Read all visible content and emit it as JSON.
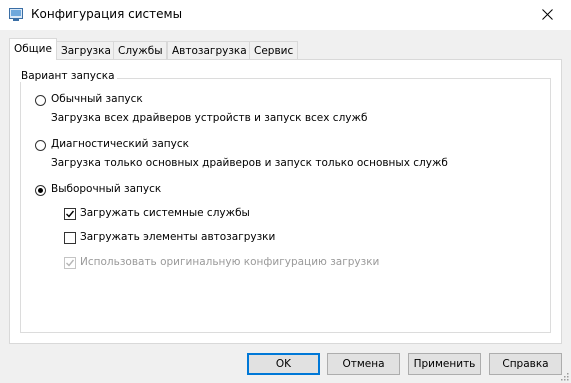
{
  "window": {
    "title": "Конфигурация системы",
    "icon": "system-config-icon"
  },
  "tabs": [
    {
      "label": "Общие",
      "active": true
    },
    {
      "label": "Загрузка",
      "active": false
    },
    {
      "label": "Службы",
      "active": false
    },
    {
      "label": "Автозагрузка",
      "active": false
    },
    {
      "label": "Сервис",
      "active": false
    }
  ],
  "group": {
    "title": "Вариант запуска",
    "options": [
      {
        "label": "Обычный запуск",
        "description": "Загрузка всех драйверов устройств и запуск всех служб",
        "selected": false
      },
      {
        "label": "Диагностический запуск",
        "description": "Загрузка только основных драйверов и запуск только основных служб",
        "selected": false
      },
      {
        "label": "Выборочный запуск",
        "selected": true
      }
    ],
    "checkboxes": [
      {
        "label": "Загружать системные службы",
        "checked": true,
        "enabled": true
      },
      {
        "label": "Загружать элементы автозагрузки",
        "checked": false,
        "enabled": true
      },
      {
        "label": "Использовать оригинальную конфигурацию загрузки",
        "checked": true,
        "enabled": false
      }
    ]
  },
  "buttons": {
    "ok": "OK",
    "cancel": "Отмена",
    "apply": "Применить",
    "help": "Справка"
  },
  "colors": {
    "accent": "#0078d7",
    "disabled_text": "#9a9a9a"
  }
}
